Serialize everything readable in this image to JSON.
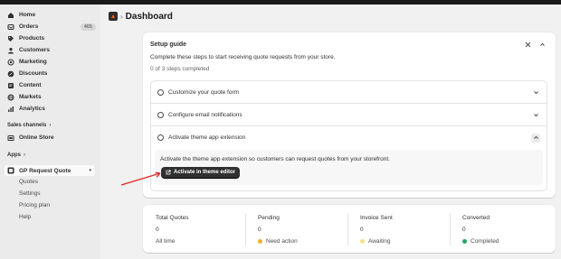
{
  "sidebar": {
    "items": [
      {
        "label": "Home",
        "icon": "home-icon"
      },
      {
        "label": "Orders",
        "icon": "orders-icon",
        "badge": "465"
      },
      {
        "label": "Products",
        "icon": "tag-icon"
      },
      {
        "label": "Customers",
        "icon": "person-icon"
      },
      {
        "label": "Marketing",
        "icon": "target-icon"
      },
      {
        "label": "Discounts",
        "icon": "discount-icon"
      },
      {
        "label": "Content",
        "icon": "content-icon"
      },
      {
        "label": "Markets",
        "icon": "globe-icon"
      },
      {
        "label": "Analytics",
        "icon": "analytics-icon"
      }
    ],
    "sales_channels_label": "Sales channels",
    "online_store_label": "Online Store",
    "apps_label": "Apps",
    "app_name": "GP Request Quote",
    "app_subitems": [
      "Quotes",
      "Settings",
      "Pricing plan",
      "Help"
    ]
  },
  "header": {
    "separator": "›",
    "title": "Dashboard"
  },
  "setup_guide": {
    "title": "Setup guide",
    "description": "Complete these steps to start receiving quote requests from your store.",
    "progress": "0 of 3 steps completed",
    "steps": [
      {
        "label": "Customize your quote form"
      },
      {
        "label": "Configure email notifications"
      },
      {
        "label": "Activate theme app extension"
      }
    ],
    "expanded_text": "Activate the theme app extension so customers can request quotes from your storefront.",
    "activate_button": "Activate in theme editor"
  },
  "stats": [
    {
      "label": "Total Quotes",
      "value": "0",
      "sub": "All time",
      "dot_color": ""
    },
    {
      "label": "Pending",
      "value": "0",
      "sub": "Need action",
      "dot_color": "#f0b12b"
    },
    {
      "label": "Invoice Sent",
      "value": "0",
      "sub": "Awaiting",
      "dot_color": "#f5e28a"
    },
    {
      "label": "Converted",
      "value": "0",
      "sub": "Completed",
      "dot_color": "#29a36a"
    }
  ],
  "colors": {
    "topbar": "#1a1a1a",
    "primary_button": "#303030",
    "annotation_arrow": "#e02424",
    "app_logo_accent": "#e8622a"
  }
}
